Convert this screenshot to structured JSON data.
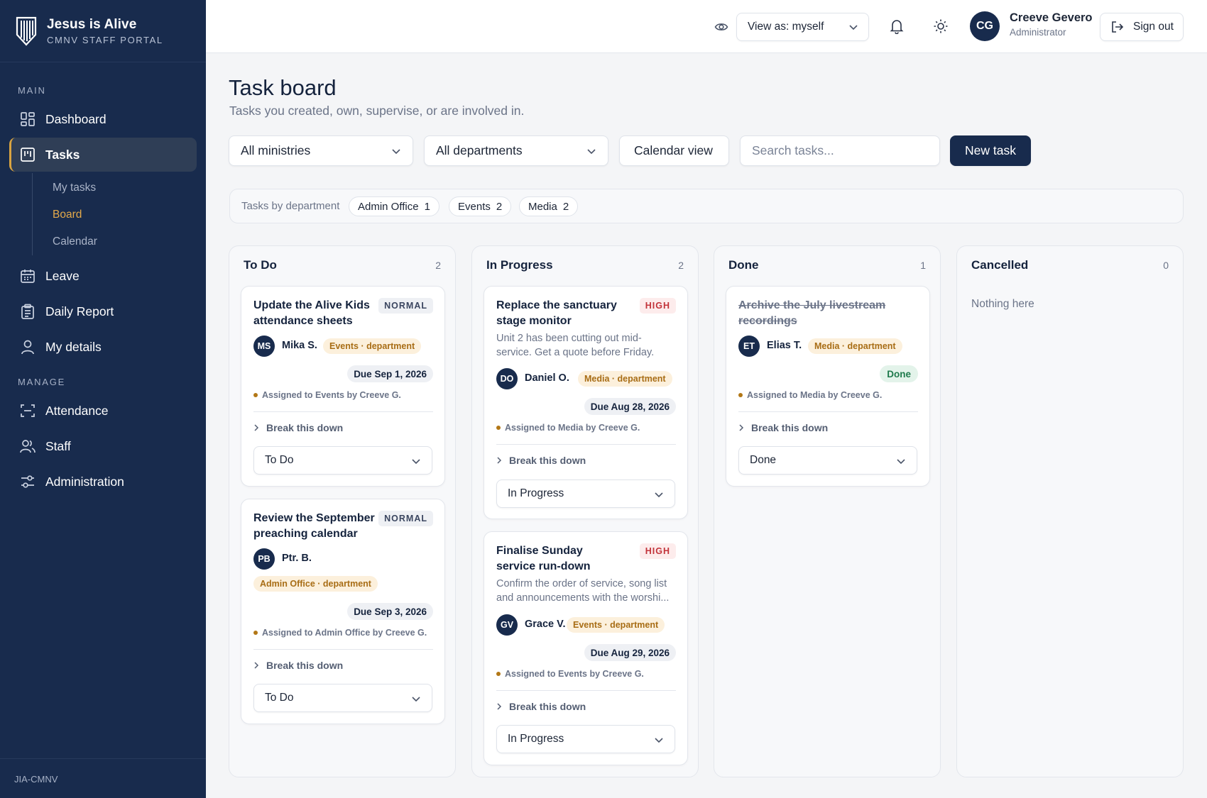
{
  "brand": {
    "title": "Jesus is Alive",
    "subtitle": "CMNV STAFF PORTAL"
  },
  "sidebar": {
    "section_main": "MAIN",
    "section_manage": "MANAGE",
    "items": {
      "dashboard": "Dashboard",
      "tasks": "Tasks",
      "leave": "Leave",
      "daily_report": "Daily Report",
      "my_details": "My details",
      "attendance": "Attendance",
      "staff": "Staff",
      "administration": "Administration"
    },
    "sub_items": {
      "my_tasks": "My tasks",
      "board": "Board",
      "calendar": "Calendar"
    },
    "footer": "JIA-CMNV"
  },
  "topbar": {
    "view_as": "View as: myself",
    "user": {
      "initials": "CG",
      "name": "Creeve Gevero",
      "role": "Administrator"
    },
    "sign_out": "Sign out"
  },
  "page": {
    "title": "Task board",
    "subtitle": "Tasks you created, own, supervise, or are involved in."
  },
  "controls": {
    "ministry": "All ministries",
    "department": "All departments",
    "calendar_view": "Calendar view",
    "search_placeholder": "Search tasks...",
    "new_task": "New task"
  },
  "filters": {
    "label": "Tasks by department",
    "chips": [
      {
        "name": "Admin Office",
        "count": "1"
      },
      {
        "name": "Events",
        "count": "2"
      },
      {
        "name": "Media",
        "count": "2"
      }
    ]
  },
  "board": {
    "break_down": "Break this down",
    "columns": [
      {
        "title": "To Do",
        "count": "2",
        "cards": [
          {
            "title": "Update the Alive Kids attendance sheets",
            "priority": "NORMAL",
            "initials": "MS",
            "owner": "Mika S.",
            "dept": "Events · department",
            "due": "Due Sep 1, 2026",
            "assigned": "Assigned to Events by Creeve G.",
            "status": "To Do"
          },
          {
            "title": "Review the September preaching calendar",
            "priority": "NORMAL",
            "initials": "PB",
            "owner": "Ptr. B.",
            "dept": "Admin Office · department",
            "due": "Due Sep 3, 2026",
            "assigned": "Assigned to Admin Office by Creeve G.",
            "status": "To Do"
          }
        ]
      },
      {
        "title": "In Progress",
        "count": "2",
        "cards": [
          {
            "title": "Replace the sanctuary stage monitor",
            "priority": "HIGH",
            "desc": "Unit 2 has been cutting out mid-service. Get a quote before Friday.",
            "initials": "DO",
            "owner": "Daniel O.",
            "dept": "Media · department",
            "due": "Due Aug 28, 2026",
            "assigned": "Assigned to Media by Creeve G.",
            "status": "In Progress"
          },
          {
            "title": "Finalise Sunday service run-down",
            "priority": "HIGH",
            "desc": "Confirm the order of service, song list and announcements with the worshi...",
            "initials": "GV",
            "owner": "Grace V.",
            "dept": "Events · department",
            "due": "Due Aug 29, 2026",
            "assigned": "Assigned to Events by Creeve G.",
            "status": "In Progress"
          }
        ]
      },
      {
        "title": "Done",
        "count": "1",
        "cards": [
          {
            "title": "Archive the July livestream recordings",
            "initials": "ET",
            "owner": "Elias T.",
            "dept": "Media · department",
            "badge": "Done",
            "assigned": "Assigned to Media by Creeve G.",
            "status": "Done"
          }
        ]
      },
      {
        "title": "Cancelled",
        "count": "0",
        "empty": "Nothing here",
        "cards": []
      }
    ]
  },
  "colors": {
    "sidebar": "#182b4d",
    "accent": "#d9a441",
    "high": "#c2333a",
    "dept_text": "#a86d15",
    "done": "#1f7a4c"
  }
}
